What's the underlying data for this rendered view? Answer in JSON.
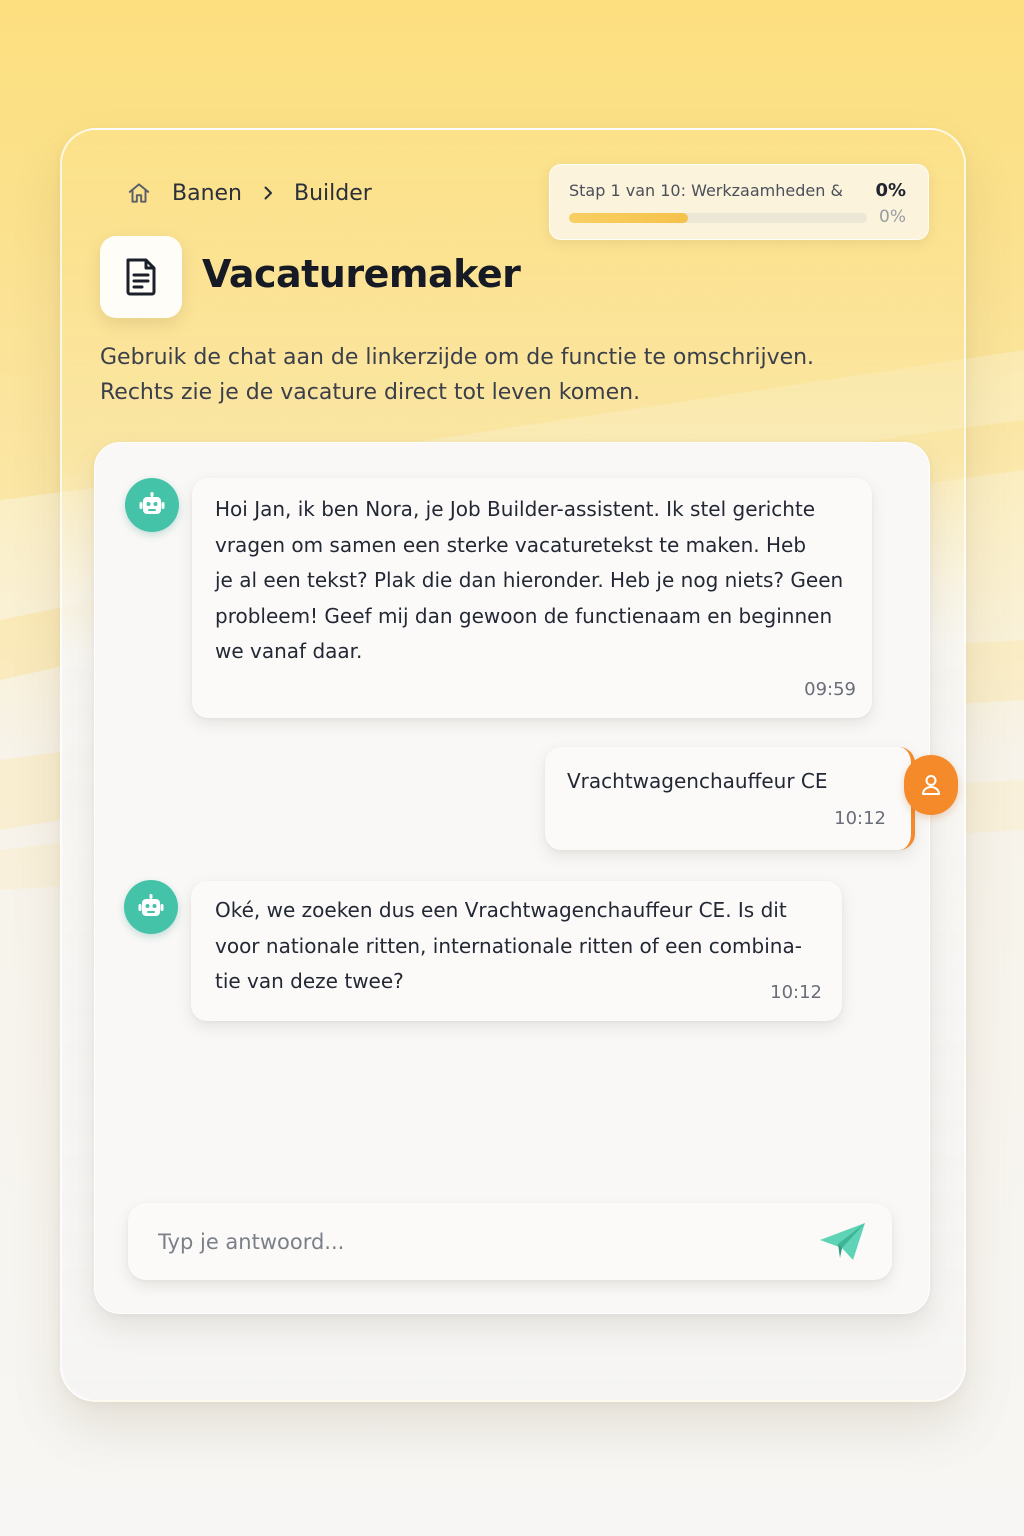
{
  "breadcrumb": {
    "home_icon": "home-icon",
    "items": [
      "Banen",
      "Builder"
    ],
    "separator_icon": "chevron-right-icon"
  },
  "progress": {
    "label": "Stap 1 van 10: Werkzaamheden &",
    "percent_label": "0%",
    "percent_sub": "0%",
    "fill_fraction": 0.4
  },
  "header": {
    "icon": "document-icon",
    "title": "Vacaturemaker",
    "subtitle_lines": [
      "Gebruik de chat aan de linkerzijde om de functie te omschrijven.",
      "Rechts zie je de vacature direct tot leven komen."
    ]
  },
  "chat": {
    "messages": [
      {
        "sender": "bot",
        "avatar_icon": "robot-icon",
        "lines": [
          "Hoi Jan, ik ben Nora, je Job Builder-assistent. Ik stel gerichte",
          "vragen om samen een sterke vacaturetekst te maken. Heb",
          "je al een tekst? Plak die dan hieronder. Heb je nog niets? Geen",
          "probleem! Geef mij dan gewoon de functienaam en beginnen",
          "we vanaf daar."
        ],
        "time": "09:59"
      },
      {
        "sender": "user",
        "avatar_icon": "user-icon",
        "lines": [
          "Vrachtwagenchauffeur CE"
        ],
        "time": "10:12"
      },
      {
        "sender": "bot",
        "avatar_icon": "robot-icon",
        "lines": [
          "Oké, we zoeken dus een Vrachtwagenchauffeur CE. Is dit",
          "voor nationale ritten, internationale ritten of een combina-",
          "tie van deze twee?"
        ],
        "time": "10:12"
      }
    ],
    "input": {
      "placeholder": "Typ je antwoord...",
      "value": ""
    },
    "send_icon": "paper-plane-icon"
  },
  "colors": {
    "accent_bot": "#45c3a8",
    "accent_user": "#f58a2b",
    "progress_fill": "#f5c24b",
    "background_top": "#fde48a"
  }
}
